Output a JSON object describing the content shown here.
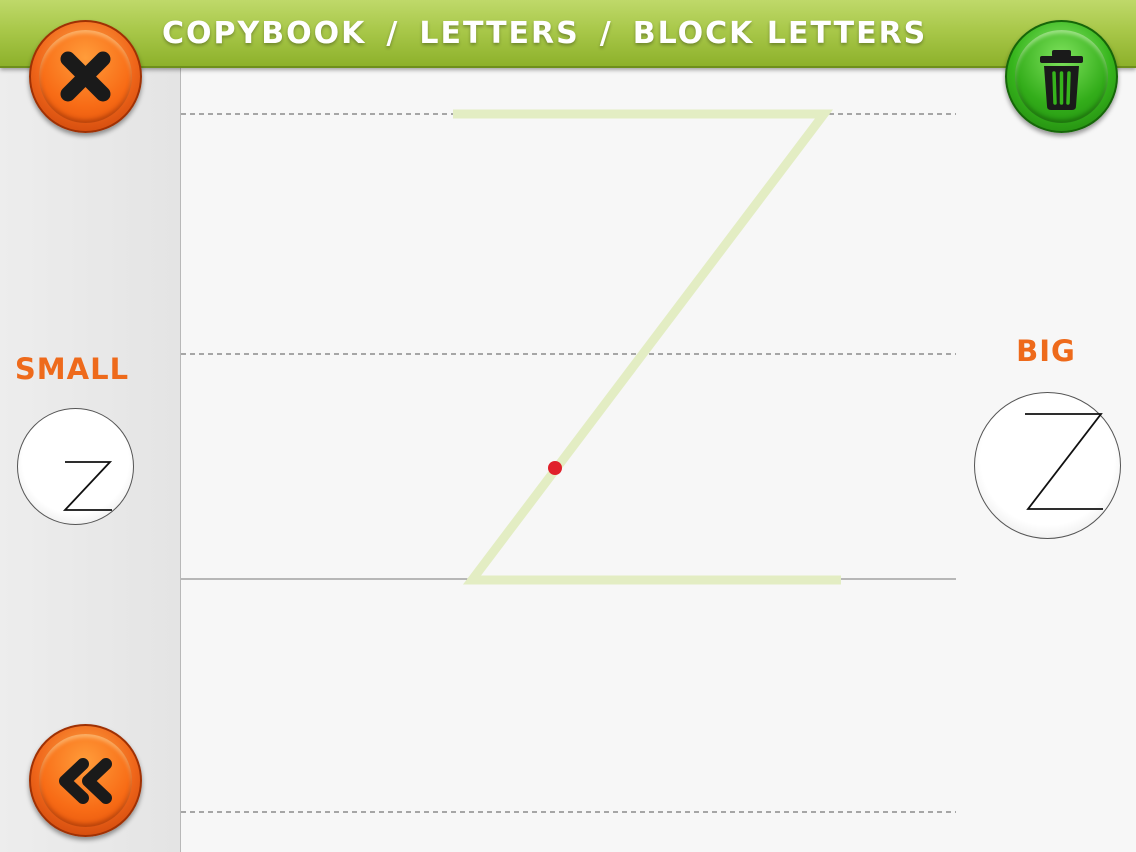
{
  "header": {
    "crumbs": [
      "COPYBOOK",
      "LETTERS",
      "BLOCK LETTERS"
    ],
    "separator": "/"
  },
  "buttons": {
    "close_icon": "close-x-icon",
    "trash_icon": "trash-can-icon",
    "back_icon": "rewind-arrows-icon"
  },
  "size_options": {
    "small_label": "SMALL",
    "big_label": "BIG"
  },
  "exercise": {
    "letter": "Z",
    "guide_color": "#e3edc3",
    "pen_color": "#e0202a"
  },
  "colors": {
    "header_green": "#a9c84a",
    "orange_button": "#f0661a",
    "green_button": "#36b51c",
    "label_orange": "#ee6a1b"
  }
}
